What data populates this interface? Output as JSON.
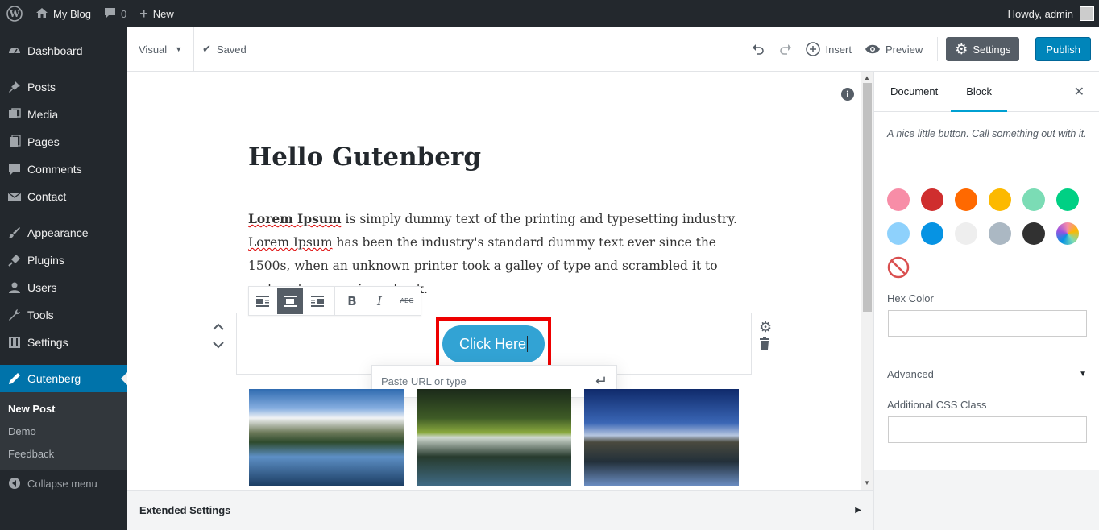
{
  "adminbar": {
    "site_name": "My Blog",
    "comments_count": "0",
    "new_label": "New",
    "howdy": "Howdy, admin"
  },
  "sidebar": {
    "items": [
      {
        "label": "Dashboard",
        "icon": "dashboard-icon"
      },
      {
        "label": "Posts",
        "icon": "pin-icon"
      },
      {
        "label": "Media",
        "icon": "media-icon"
      },
      {
        "label": "Pages",
        "icon": "pages-icon"
      },
      {
        "label": "Comments",
        "icon": "comment-icon"
      },
      {
        "label": "Contact",
        "icon": "mail-icon"
      },
      {
        "label": "Appearance",
        "icon": "brush-icon"
      },
      {
        "label": "Plugins",
        "icon": "plug-icon"
      },
      {
        "label": "Users",
        "icon": "user-icon"
      },
      {
        "label": "Tools",
        "icon": "wrench-icon"
      },
      {
        "label": "Settings",
        "icon": "sliders-icon"
      },
      {
        "label": "Gutenberg",
        "icon": "pencil-icon"
      }
    ],
    "submenu": [
      "New Post",
      "Demo",
      "Feedback"
    ],
    "collapse": "Collapse menu"
  },
  "header": {
    "mode": "Visual",
    "saved": "Saved",
    "insert": "Insert",
    "preview": "Preview",
    "settings": "Settings",
    "publish": "Publish"
  },
  "post": {
    "title": "Hello Gutenberg",
    "para_bold": "Lorem Ipsum",
    "para_1": " is simply dummy text of the printing and typesetting industry. ",
    "para_squig": "Lorem Ipsum",
    "para_2": " has been the industry's standard dummy text ever since the 1500s, when an unknown printer took a galley of type and scrambled it to make a type specimen book.",
    "button_text": "Click Here",
    "url_placeholder": "Paste URL or type"
  },
  "extended": {
    "label": "Extended Settings"
  },
  "panel": {
    "tab_document": "Document",
    "tab_block": "Block",
    "description": "A nice little button. Call something out with it.",
    "hex_label": "Hex Color",
    "advanced": "Advanced",
    "css_label": "Additional CSS Class",
    "colors": [
      "#f78da7",
      "#cf2e2e",
      "#ff6900",
      "#fcb900",
      "#7bdcb5",
      "#00d084",
      "#8ed1fc",
      "#0693e3",
      "#eeeeee",
      "#abb8c3",
      "#313131"
    ]
  }
}
